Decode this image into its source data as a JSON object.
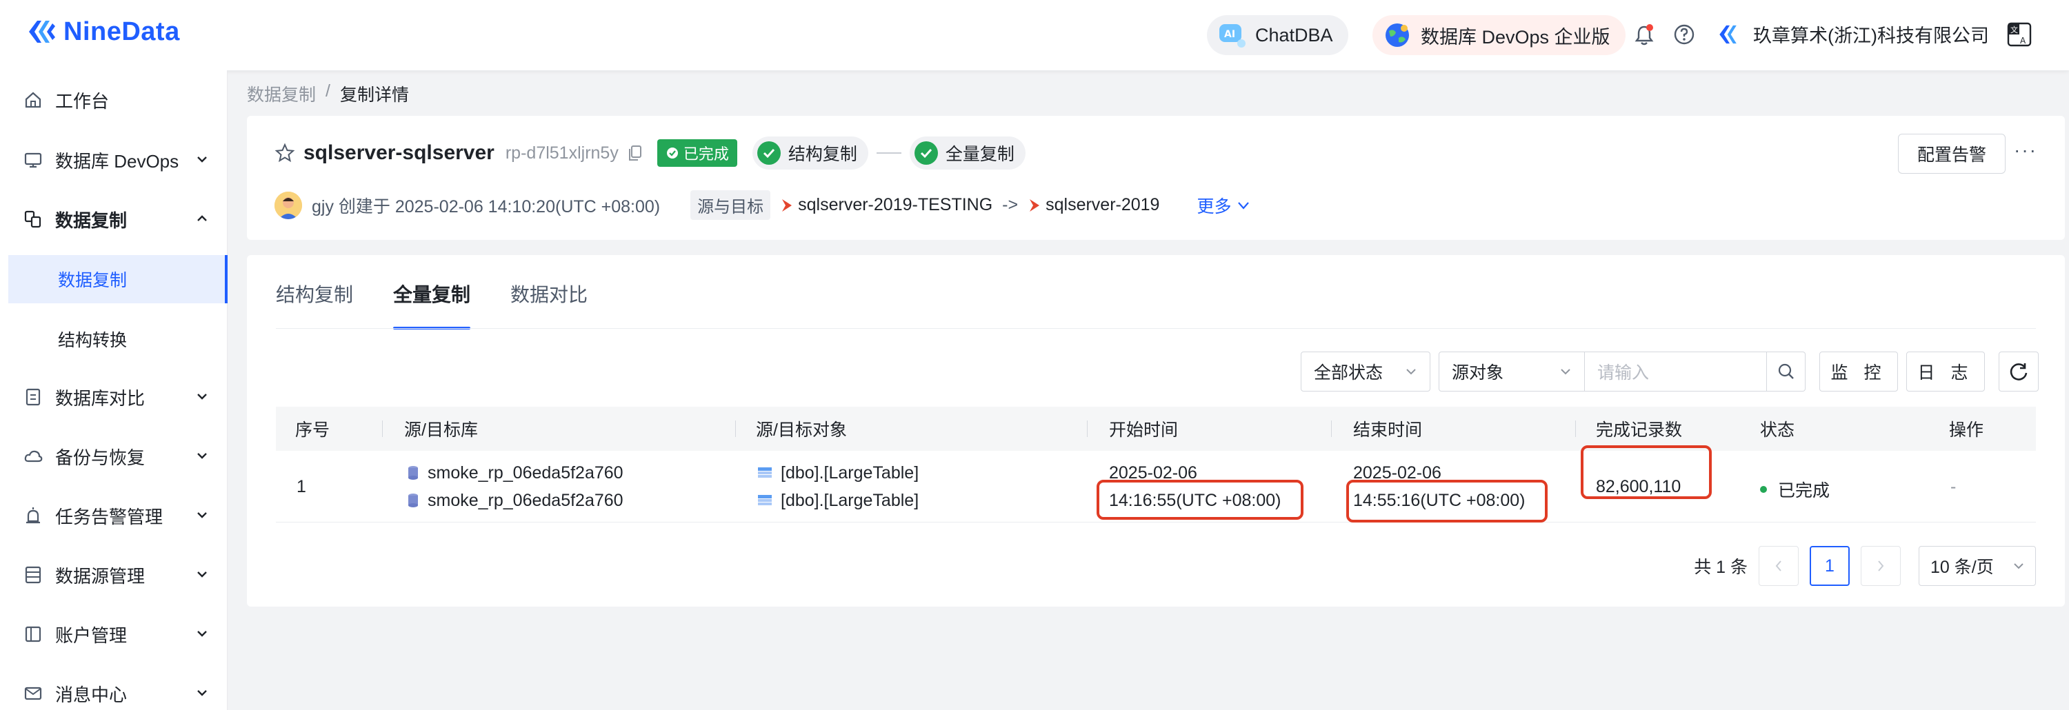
{
  "app": {
    "logo_text": "NineData"
  },
  "header": {
    "chatdba_label": "ChatDBA",
    "devops_label": "数据库 DevOps 企业版",
    "company": "玖章算术(浙江)科技有限公司"
  },
  "sidebar": {
    "items": [
      {
        "label": "工作台",
        "icon": "home-icon"
      },
      {
        "label": "数据库 DevOps",
        "icon": "monitor-icon"
      },
      {
        "label": "数据复制",
        "icon": "replication-icon"
      },
      {
        "label": "数据库对比",
        "icon": "compare-icon"
      },
      {
        "label": "备份与恢复",
        "icon": "cloud-icon"
      },
      {
        "label": "任务告警管理",
        "icon": "alarm-icon"
      },
      {
        "label": "数据源管理",
        "icon": "datasource-icon"
      },
      {
        "label": "账户管理",
        "icon": "account-icon"
      },
      {
        "label": "消息中心",
        "icon": "mail-icon"
      }
    ],
    "sub_items": [
      {
        "label": "数据复制"
      },
      {
        "label": "结构转换"
      }
    ]
  },
  "breadcrumb": {
    "parent": "数据复制",
    "separator": "/",
    "current": "复制详情"
  },
  "task": {
    "name": "sqlserver-sqlserver",
    "id": "rp-d7l51xljrn5y",
    "status": "已完成",
    "steps": [
      "结构复制",
      "全量复制"
    ],
    "creator_line": "gjy 创建于 2025-02-06 14:10:20(UTC +08:00)",
    "src_target_label": "源与目标",
    "source": "sqlserver-2019-TESTING",
    "arrow": "->",
    "target": "sqlserver-2019",
    "more": "更多",
    "alert_button": "配置告警",
    "more_dots": "···"
  },
  "tabs": [
    {
      "label": "结构复制",
      "active": false
    },
    {
      "label": "全量复制",
      "active": true
    },
    {
      "label": "数据对比",
      "active": false
    }
  ],
  "filters": {
    "status": "全部状态",
    "object": "源对象",
    "search_placeholder": "请输入",
    "monitor": "监 控",
    "log": "日 志"
  },
  "table": {
    "headers": [
      "序号",
      "源/目标库",
      "源/目标对象",
      "开始时间",
      "结束时间",
      "完成记录数",
      "状态",
      "操作"
    ],
    "rows": [
      {
        "index": "1",
        "src_db": "smoke_rp_06eda5f2a760",
        "dst_db": "smoke_rp_06eda5f2a760",
        "src_obj": "[dbo].[LargeTable]",
        "dst_obj": "[dbo].[LargeTable]",
        "start_date": "2025-02-06",
        "start_time": "14:16:55(UTC +08:00)",
        "end_date": "2025-02-06",
        "end_time": "14:55:16(UTC +08:00)",
        "records": "82,600,110",
        "status": "已完成",
        "action": "-"
      }
    ]
  },
  "pagination": {
    "total": "共 1 条",
    "current": "1",
    "page_size": "10 条/页"
  },
  "colors": {
    "brand": "#1f5eff",
    "success": "#23a756",
    "highlight": "#e03b24"
  }
}
